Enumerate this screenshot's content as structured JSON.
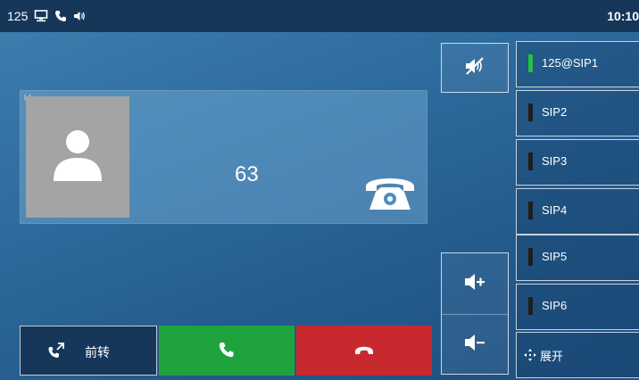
{
  "status_bar": {
    "account": "125",
    "time": "10:10",
    "icons": [
      "network-icon",
      "call-icon",
      "handsfree-icon"
    ]
  },
  "call": {
    "line_tag": "L1",
    "caller_number": "63",
    "avatar_icon": "person-icon",
    "state_icon": "ringing-phone-icon"
  },
  "controls": {
    "mute_icon": "speaker-mute-icon",
    "volume_up_icon": "volume-up-icon",
    "volume_down_icon": "volume-down-icon"
  },
  "line_keys": [
    {
      "label": "125@SIP1",
      "active": true
    },
    {
      "label": "SIP2",
      "active": false
    },
    {
      "label": "SIP3",
      "active": false
    },
    {
      "label": "SIP4",
      "active": false
    },
    {
      "label": "SIP5",
      "active": false
    },
    {
      "label": "SIP6",
      "active": false
    }
  ],
  "expand": {
    "label": "展开",
    "icon": "expand-icon"
  },
  "softkeys": {
    "forward_label": "前转",
    "forward_icon": "call-forward-icon",
    "answer_icon": "answer-icon",
    "reject_icon": "hangup-icon"
  },
  "colors": {
    "answer": "#1ea33f",
    "reject": "#c8292f",
    "active_line": "#22c243",
    "status_bar": "#16365a"
  }
}
